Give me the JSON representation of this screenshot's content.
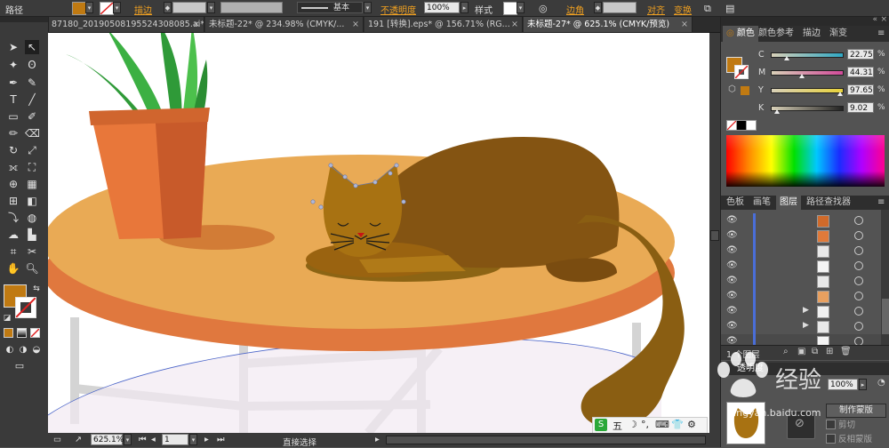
{
  "control_bar": {
    "object_type": "路径",
    "stroke_label": "描边",
    "stroke_style": "基本",
    "opacity_label": "不透明度",
    "opacity_value": "100%",
    "style_label": "样式",
    "corner_label": "边角",
    "align_label": "对齐",
    "transform_label": "变换",
    "fill_color": "#c07a12",
    "accent": "#f0a020"
  },
  "tabs": [
    {
      "label": "87180_20190508195524308085.ai*"
    },
    {
      "label": "未标题-22* @ 234.98% (CMYK/..."
    },
    {
      "label": "191 [转换].eps* @ 156.71% (RG..."
    },
    {
      "label": "未标题-27* @ 625.1% (CMYK/预览)"
    }
  ],
  "status_bar": {
    "zoom": "625.1%",
    "artboard": "1",
    "tool_name": "直接选择"
  },
  "color_panel": {
    "tabs": [
      "颜色",
      "颜色参考",
      "描边",
      "渐变"
    ],
    "channels": [
      {
        "name": "C",
        "value": "22.75",
        "pct": 0.2275,
        "color": "#2fa8c4"
      },
      {
        "name": "M",
        "value": "44.31",
        "pct": 0.4431,
        "color": "#d24a9a"
      },
      {
        "name": "Y",
        "value": "97.65",
        "pct": 0.9765,
        "color": "#e8d23a"
      },
      {
        "name": "K",
        "value": "9.02",
        "pct": 0.0902,
        "color": "#222222"
      }
    ]
  },
  "layers_panel": {
    "tabs": [
      "色板",
      "画笔",
      "图层",
      "路径查找器"
    ],
    "count_label": "1 个图层"
  },
  "transparency_panel": {
    "tab": "透明度",
    "opacity": "100%",
    "make_mask_button": "制作蒙版",
    "clip_label": "剪切",
    "invert_mask_label": "反相蒙版"
  },
  "ime_bar": {
    "items": [
      "五",
      "☽",
      "°,",
      "⌨",
      "👕",
      "⚙"
    ]
  },
  "watermark": "jingyan.baidu.com"
}
